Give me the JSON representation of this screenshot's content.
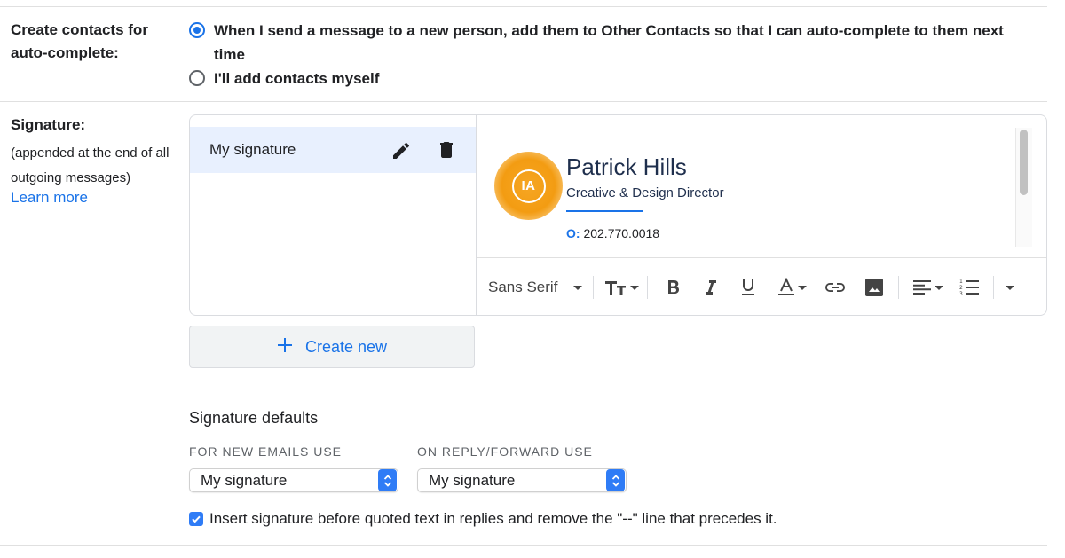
{
  "create_contacts": {
    "label": "Create contacts for auto-complete:",
    "options": [
      {
        "label": "When I send a message to a new person, add them to Other Contacts so that I can auto-complete to them next time",
        "selected": true
      },
      {
        "label": "I'll add contacts myself",
        "selected": false
      }
    ]
  },
  "signature": {
    "label": "Signature:",
    "description": "(appended at the end of all outgoing messages)",
    "learn_more": "Learn more",
    "list": [
      {
        "name": "My signature",
        "selected": true,
        "icons": [
          "pencil-icon",
          "trash-icon"
        ]
      }
    ],
    "content": {
      "logo_text": "IA",
      "name": "Patrick Hills",
      "role": "Creative & Design Director",
      "phone_label": "O:",
      "phone": "202.770.0018"
    },
    "toolbar": {
      "font": "Sans Serif",
      "icons": [
        "text-size-icon",
        "bold-icon",
        "italic-icon",
        "underline-icon",
        "text-color-icon",
        "link-icon",
        "image-icon",
        "align-icon",
        "numbered-list-icon",
        "more-options-icon"
      ]
    },
    "create_new": "Create new"
  },
  "defaults": {
    "title": "Signature defaults",
    "new_emails_label": "FOR NEW EMAILS USE",
    "new_emails_value": "My signature",
    "reply_label": "ON REPLY/FORWARD USE",
    "reply_value": "My signature",
    "insert_before_quoted": "Insert signature before quoted text in replies and remove the \"--\" line that precedes it.",
    "insert_before_quoted_checked": true
  },
  "colors": {
    "accent": "#1a73e8",
    "selected_bg": "#e8f0fe",
    "logo": "#f39c12",
    "mac_select": "#2f7cf6"
  }
}
